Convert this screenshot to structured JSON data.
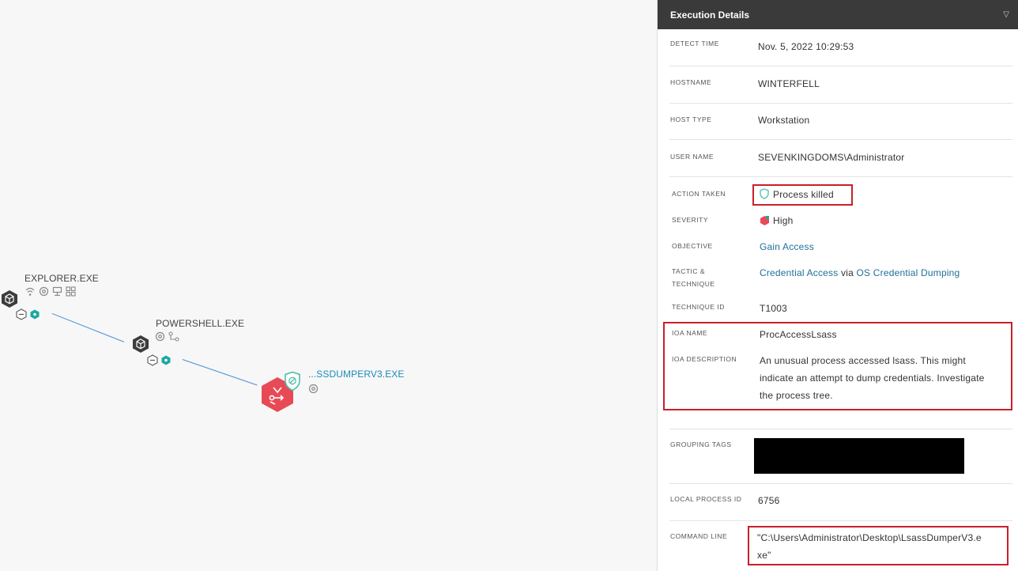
{
  "graph": {
    "nodes": [
      {
        "name": "EXPLORER.EXE"
      },
      {
        "name": "POWERSHELL.EXE"
      },
      {
        "name": "...SSDUMPERV3.EXE"
      }
    ]
  },
  "panel": {
    "title": "Execution Details",
    "fields": {
      "detect_time": {
        "label": "DETECT TIME",
        "value": "Nov. 5, 2022 10:29:53"
      },
      "hostname": {
        "label": "HOSTNAME",
        "value": "WINTERFELL"
      },
      "host_type": {
        "label": "HOST TYPE",
        "value": "Workstation"
      },
      "user_name": {
        "label": "USER NAME",
        "value": "SEVENKINGDOMS\\Administrator"
      },
      "action_taken": {
        "label": "ACTION TAKEN",
        "value": "Process killed"
      },
      "severity": {
        "label": "SEVERITY",
        "value": "High"
      },
      "objective": {
        "label": "OBJECTIVE",
        "value": "Gain Access"
      },
      "tactic": {
        "label_line1": "TACTIC &",
        "label_line2": "TECHNIQUE",
        "tactic": "Credential Access",
        "via": "via",
        "technique": "OS Credential Dumping"
      },
      "technique_id": {
        "label": "TECHNIQUE ID",
        "value": "T1003"
      },
      "ioa_name": {
        "label": "IOA NAME",
        "value": "ProcAccessLsass"
      },
      "ioa_description": {
        "label": "IOA DESCRIPTION",
        "line1": "An unusual process accessed lsass. This might",
        "line2": "indicate an attempt to dump credentials. Investigate",
        "line3": "the process tree."
      },
      "grouping_tags": {
        "label": "GROUPING TAGS"
      },
      "local_process_id": {
        "label": "LOCAL PROCESS ID",
        "value": "6756"
      },
      "command_line": {
        "label": "COMMAND LINE",
        "line1": "\"C:\\Users\\Administrator\\Desktop\\LsassDumperV3.e",
        "line2": "xe\""
      }
    }
  },
  "colors": {
    "header_bg": "#3a3a3a",
    "highlight_red": "#c8202a",
    "alert_node": "#e84a55",
    "link": "#1f6f99",
    "edge": "#4a90d9",
    "teal": "#1aa9a0"
  }
}
